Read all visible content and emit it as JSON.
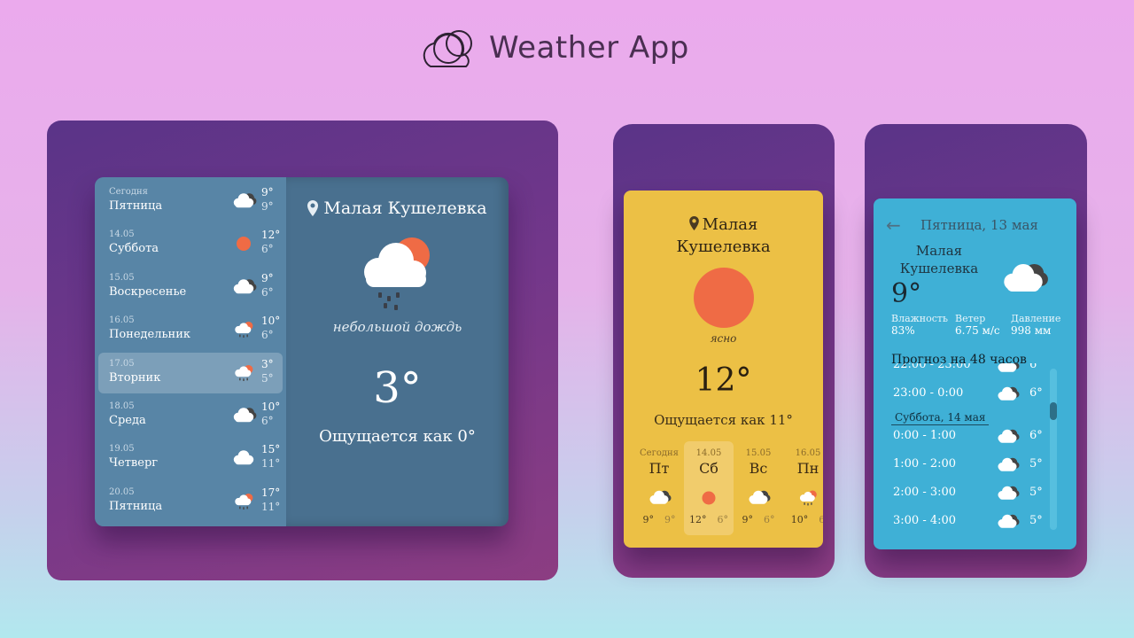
{
  "header": {
    "title": "Weather App",
    "logo": "clouds-logo-icon"
  },
  "desktop": {
    "location": "Малая Кушелевка",
    "condition": "небольшой дождь",
    "temp": "3°",
    "feels": "Ощущается как 0°",
    "days": [
      {
        "date": "Сегодня",
        "name": "Пятница",
        "hi": "9°",
        "lo": "9°",
        "icon": "cloudy-icon"
      },
      {
        "date": "14.05",
        "name": "Суббота",
        "hi": "12°",
        "lo": "6°",
        "icon": "sun-icon"
      },
      {
        "date": "15.05",
        "name": "Воскресенье",
        "hi": "9°",
        "lo": "6°",
        "icon": "cloudy-icon"
      },
      {
        "date": "16.05",
        "name": "Понедельник",
        "hi": "10°",
        "lo": "6°",
        "icon": "rain-sun-icon"
      },
      {
        "date": "17.05",
        "name": "Вторник",
        "hi": "3°",
        "lo": "5°",
        "icon": "rain-sun-icon"
      },
      {
        "date": "18.05",
        "name": "Среда",
        "hi": "10°",
        "lo": "6°",
        "icon": "cloudy-icon"
      },
      {
        "date": "19.05",
        "name": "Четверг",
        "hi": "15°",
        "lo": "11°",
        "icon": "cloud-icon"
      },
      {
        "date": "20.05",
        "name": "Пятница",
        "hi": "17°",
        "lo": "11°",
        "icon": "rain-sun-icon"
      }
    ]
  },
  "yellow": {
    "location_line1": "Малая",
    "location_line2": "Кушелевка",
    "condition": "ясно",
    "temp": "12°",
    "feels": "Ощущается как 11°",
    "forecast": [
      {
        "date": "Сегодня",
        "wd": "Пт",
        "hi": "9°",
        "lo": "9°",
        "icon": "cloudy-icon"
      },
      {
        "date": "14.05",
        "wd": "Сб",
        "hi": "12°",
        "lo": "6°",
        "icon": "sun-icon"
      },
      {
        "date": "15.05",
        "wd": "Вс",
        "hi": "9°",
        "lo": "6°",
        "icon": "cloudy-icon"
      },
      {
        "date": "16.05",
        "wd": "Пн",
        "hi": "10°",
        "lo": "6",
        "icon": "rain-sun-icon"
      }
    ]
  },
  "blue": {
    "title": "Пятница, 13 мая",
    "location_line1": "Малая",
    "location_line2": "Кушелевка",
    "temp": "9°",
    "humidity_label": "Влажность",
    "humidity": "83%",
    "wind_label": "Ветер",
    "wind": "6.75 м/с",
    "pressure_label": "Давление",
    "pressure": "998 мм",
    "forecast_title": "Прогноз на 48 часов",
    "hours_a": [
      {
        "time": "22:00 - 23:00",
        "t": "6°"
      },
      {
        "time": "23:00 - 0:00",
        "t": "6°"
      }
    ],
    "day_divider": "Суббота, 14 мая",
    "hours_b": [
      {
        "time": "0:00 - 1:00",
        "t": "6°"
      },
      {
        "time": "1:00 - 2:00",
        "t": "5°"
      },
      {
        "time": "2:00 - 3:00",
        "t": "5°"
      },
      {
        "time": "3:00 - 4:00",
        "t": "5°"
      }
    ]
  }
}
